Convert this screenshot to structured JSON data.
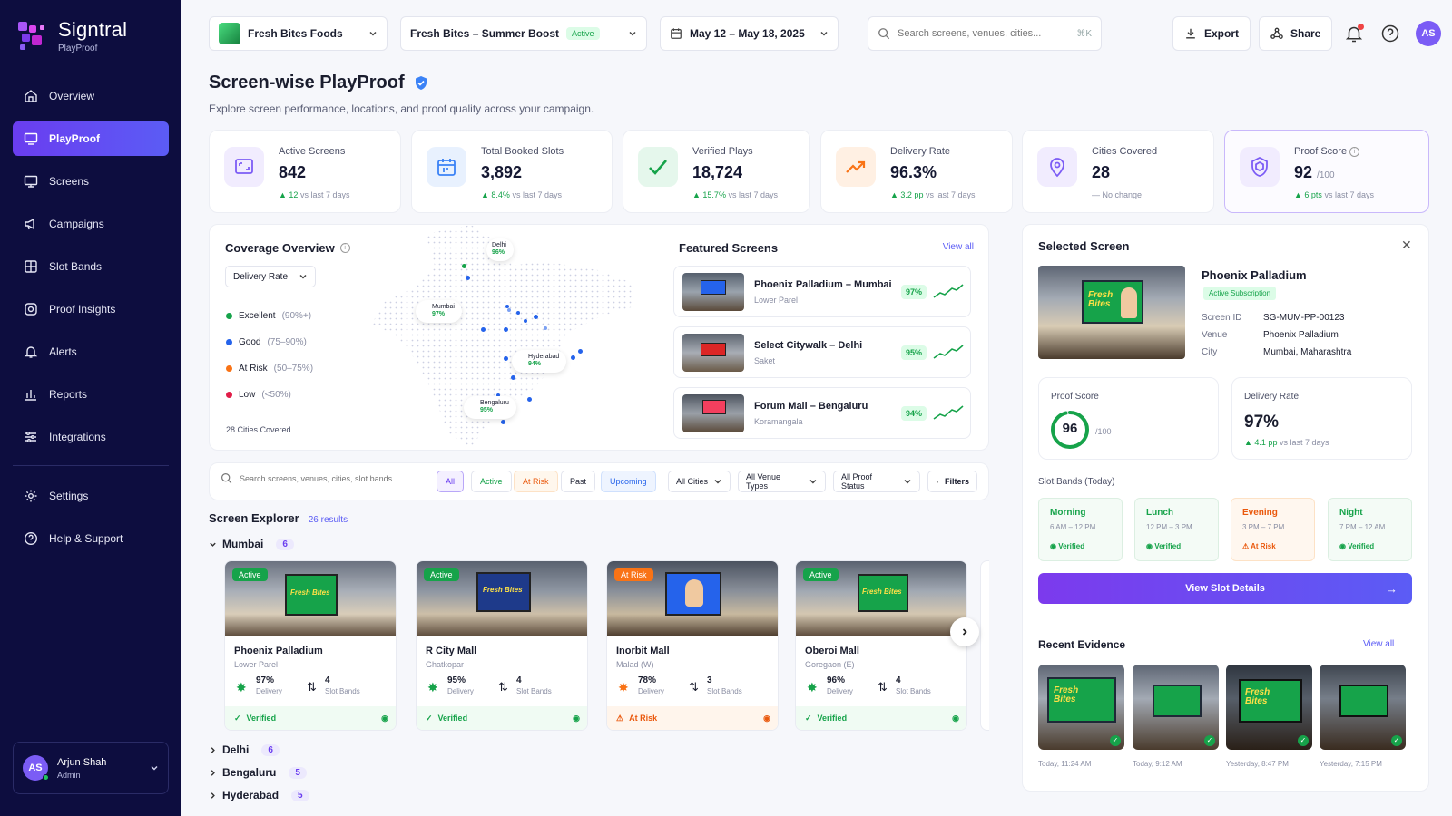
{
  "brand": {
    "name": "Signtral",
    "sub": "PlayProof"
  },
  "nav": {
    "items": [
      {
        "label": "Overview"
      },
      {
        "label": "PlayProof"
      },
      {
        "label": "Screens"
      },
      {
        "label": "Campaigns"
      },
      {
        "label": "Slot Bands"
      },
      {
        "label": "Proof Insights"
      },
      {
        "label": "Alerts"
      },
      {
        "label": "Reports"
      },
      {
        "label": "Integrations"
      },
      {
        "label": "Settings"
      },
      {
        "label": "Help & Support"
      }
    ]
  },
  "user": {
    "initials": "AS",
    "name": "Arjun Shah",
    "role": "Admin"
  },
  "topbar": {
    "brand": "Fresh Bites Foods",
    "campaign": "Fresh Bites – Summer Boost",
    "campaign_status": "Active",
    "date_range": "May 12 – May 18, 2025",
    "search_placeholder": "Search screens, venues, cities...",
    "shortcut": "⌘K",
    "export": "Export",
    "share": "Share",
    "avatar": "AS"
  },
  "page": {
    "title": "Screen-wise PlayProof",
    "subtitle": "Explore screen performance, locations, and proof quality across your campaign."
  },
  "stats": [
    {
      "label": "Active Screens",
      "value": "842",
      "unit": "",
      "trend": "12",
      "trend_text": "vs last 7 days",
      "color": "#7c5cf5",
      "bg": "#f1ecfe"
    },
    {
      "label": "Total Booked Slots",
      "value": "3,892",
      "unit": "",
      "trend": "8.4%",
      "trend_text": "vs last 7 days",
      "color": "#3b82f6",
      "bg": "#e8f1fe"
    },
    {
      "label": "Verified Plays",
      "value": "18,724",
      "unit": "",
      "trend": "15.7%",
      "trend_text": "vs last 7 days",
      "color": "#16a34a",
      "bg": "#e5f7ec"
    },
    {
      "label": "Delivery Rate",
      "value": "96.3%",
      "unit": "",
      "trend": "3.2 pp",
      "trend_text": "vs last 7 days",
      "color": "#f97316",
      "bg": "#fff0e3"
    },
    {
      "label": "Cities Covered",
      "value": "28",
      "unit": "",
      "trend": "",
      "trend_text": "— No change",
      "color": "#7c5cf5",
      "bg": "#f1ecfe"
    },
    {
      "label": "Proof Score",
      "value": "92",
      "unit": "/100",
      "trend": "6 pts",
      "trend_text": "vs last 7 days",
      "color": "#7c5cf5",
      "bg": "#f1ecfe"
    }
  ],
  "coverage": {
    "title": "Coverage Overview",
    "metric": "Delivery Rate",
    "legend": [
      {
        "label": "Excellent",
        "range": "(90%+)",
        "color": "#16a34a"
      },
      {
        "label": "Good",
        "range": "(75–90%)",
        "color": "#2563eb"
      },
      {
        "label": "At Risk",
        "range": "(50–75%)",
        "color": "#f97316"
      },
      {
        "label": "Low",
        "range": "(<50%)",
        "color": "#e11d48"
      }
    ],
    "cities_covered": "28 Cities Covered",
    "markers": [
      {
        "city": "Delhi",
        "pct": "96%"
      },
      {
        "city": "Mumbai",
        "pct": "97%"
      },
      {
        "city": "Hyderabad",
        "pct": "94%"
      },
      {
        "city": "Bengaluru",
        "pct": "95%"
      }
    ]
  },
  "featured": {
    "title": "Featured Screens",
    "view_all": "View all",
    "items": [
      {
        "name": "Phoenix Palladium – Mumbai",
        "loc": "Lower Parel",
        "pct": "97%"
      },
      {
        "name": "Select Citywalk – Delhi",
        "loc": "Saket",
        "pct": "95%"
      },
      {
        "name": "Forum Mall – Bengaluru",
        "loc": "Koramangala",
        "pct": "94%"
      }
    ]
  },
  "filters": {
    "search_placeholder": "Search screens, venues, cities, slot bands...",
    "chips": [
      "All",
      "Active",
      "At Risk",
      "Past",
      "Upcoming"
    ],
    "dropdowns": [
      "All Cities",
      "All Venue Types",
      "All Proof Status"
    ],
    "filters_label": "Filters"
  },
  "explorer": {
    "title": "Screen Explorer",
    "results": "26 results",
    "groups": [
      {
        "city": "Mumbai",
        "count": "6"
      },
      {
        "city": "Delhi",
        "count": "6"
      },
      {
        "city": "Bengaluru",
        "count": "5"
      },
      {
        "city": "Hyderabad",
        "count": "5"
      }
    ],
    "delivery_label": "Delivery",
    "slot_label": "Slot Bands",
    "cards": [
      {
        "status": "Active",
        "name": "Phoenix Palladium",
        "loc": "Lower Parel",
        "delivery": "97%",
        "slots": "4",
        "proof": "Verified"
      },
      {
        "status": "Active",
        "name": "R City Mall",
        "loc": "Ghatkopar",
        "delivery": "95%",
        "slots": "4",
        "proof": "Verified"
      },
      {
        "status": "At Risk",
        "name": "Inorbit Mall",
        "loc": "Malad (W)",
        "delivery": "78%",
        "slots": "3",
        "proof": "At Risk"
      },
      {
        "status": "Active",
        "name": "Oberoi Mall",
        "loc": "Goregaon (E)",
        "delivery": "96%",
        "slots": "4",
        "proof": "Verified"
      }
    ]
  },
  "selected": {
    "title": "Selected Screen",
    "name": "Phoenix Palladium",
    "subscription": "Active Subscription",
    "fields": [
      {
        "label": "Screen ID",
        "value": "SG-MUM-PP-00123"
      },
      {
        "label": "Venue",
        "value": "Phoenix Palladium"
      },
      {
        "label": "City",
        "value": "Mumbai, Maharashtra"
      }
    ],
    "proof_label": "Proof Score",
    "proof_value": "96",
    "proof_max": "/100",
    "proof_fraction": 0.96,
    "delivery_label": "Delivery Rate",
    "delivery_value": "97%",
    "delivery_trend": "4.1 pp",
    "delivery_trend_text": "vs last 7 days",
    "slot_title": "Slot Bands (Today)",
    "slots": [
      {
        "name": "Morning",
        "hours": "6 AM – 12 PM",
        "status": "Verified"
      },
      {
        "name": "Lunch",
        "hours": "12 PM – 3 PM",
        "status": "Verified"
      },
      {
        "name": "Evening",
        "hours": "3 PM – 7 PM",
        "status": "At Risk"
      },
      {
        "name": "Night",
        "hours": "7 PM – 12 AM",
        "status": "Verified"
      }
    ],
    "cta": "View Slot Details",
    "evidence_title": "Recent Evidence",
    "evidence_view_all": "View all",
    "evidence": [
      {
        "time": "Today, 11:24 AM"
      },
      {
        "time": "Today, 9:12 AM"
      },
      {
        "time": "Yesterday, 8:47 PM"
      },
      {
        "time": "Yesterday, 7:15 PM"
      }
    ],
    "screen_text": "Fresh Bites"
  }
}
